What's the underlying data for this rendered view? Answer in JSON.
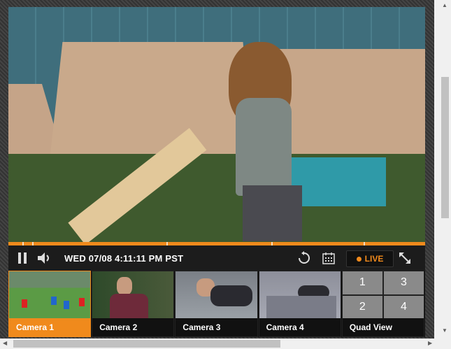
{
  "player": {
    "datetime": "WED 07/08 4:11:11 PM PST",
    "live_label": "LIVE",
    "accent_color": "#f08a1c"
  },
  "icons": {
    "pause": "pause-icon",
    "volume": "speaker-icon",
    "replay": "replay-icon",
    "calendar": "calendar-icon",
    "expand": "fullscreen-icon"
  },
  "cameras": [
    {
      "label": "Camera 1",
      "active": true
    },
    {
      "label": "Camera 2",
      "active": false
    },
    {
      "label": "Camera 3",
      "active": false
    },
    {
      "label": "Camera 4",
      "active": false
    }
  ],
  "quad": {
    "label": "Quad View",
    "cells": [
      "1",
      "3",
      "2",
      "4"
    ]
  }
}
